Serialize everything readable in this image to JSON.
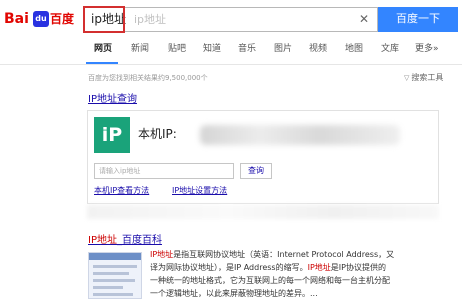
{
  "logo": {
    "bai": "Bai",
    "du": "du",
    "word": "百度"
  },
  "search": {
    "query": "ip地址",
    "suggestion": "ip地址",
    "clear_icon": "close-icon",
    "button_label": "百度一下"
  },
  "tabs": [
    {
      "label": "网页",
      "active": true
    },
    {
      "label": "新闻"
    },
    {
      "label": "贴吧"
    },
    {
      "label": "知道"
    },
    {
      "label": "音乐"
    },
    {
      "label": "图片"
    },
    {
      "label": "视频"
    },
    {
      "label": "地图"
    },
    {
      "label": "文库"
    },
    {
      "label": "更多»"
    }
  ],
  "result_count": "百度为您找到相关结果约9,500,000个",
  "search_tools": "搜索工具",
  "ip_card": {
    "title_em": "IP地址",
    "title_rest": "查询",
    "icon_text": "iP",
    "label": "本机IP:",
    "input_placeholder": "请输入ip地址",
    "query_button": "查询",
    "link_1": "本机IP查看方法",
    "link_2": "IP地址设置方法"
  },
  "baike": {
    "title_em": "IP地址",
    "title_rest": "_百度百科",
    "snippet_line1_em": "IP地址",
    "snippet_line1": "是指互联网协议地址（英语：Internet Protocol Address，又",
    "snippet_line2": "译为网际协议地址），是IP Address的缩写。",
    "snippet_line2_em": "IP地址",
    "snippet_line2_rest": "是IP协议提供的",
    "snippet_line3": "一种统一的地址格式，它为互联网上的每一个网络和每一台主机分配",
    "snippet_line4": "一个逻辑地址，以此来屏蔽物理地址的差异。..."
  },
  "colors": {
    "accent": "#3385ff",
    "brand_red": "#e10602",
    "link": "#1a0dab",
    "highlight": "#c00000",
    "ip_icon": "#1aa37a"
  }
}
